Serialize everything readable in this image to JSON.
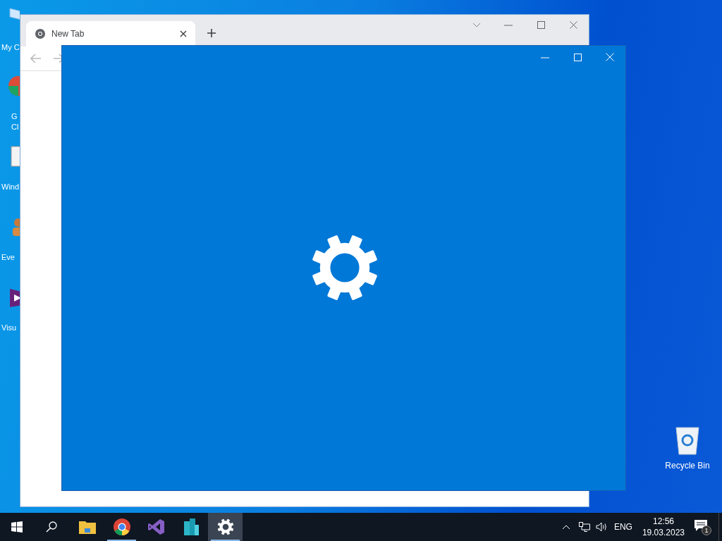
{
  "desktop_icons": [
    {
      "kind": "pc",
      "lines": [
        "My C"
      ]
    },
    {
      "kind": "chrome",
      "lines": [
        "G",
        "Cl"
      ]
    },
    {
      "kind": "notepad",
      "lines": [
        "Wind"
      ]
    },
    {
      "kind": "person",
      "lines": [
        "Eve"
      ]
    },
    {
      "kind": "vs",
      "lines": [
        "Visu"
      ]
    }
  ],
  "recycle_bin": {
    "label": "Recycle Bin"
  },
  "browser": {
    "tabs": [
      {
        "title": "New Tab",
        "selected": true
      }
    ]
  },
  "settings_window": {
    "kind": "splash"
  },
  "taskbar": {
    "items": [
      {
        "kind": "start",
        "running": false,
        "active": false
      },
      {
        "kind": "search",
        "running": false,
        "active": false
      },
      {
        "kind": "explorer",
        "running": false,
        "active": false
      },
      {
        "kind": "chrome",
        "running": true,
        "active": false
      },
      {
        "kind": "vs",
        "running": false,
        "active": false
      },
      {
        "kind": "buildings",
        "running": false,
        "active": false
      },
      {
        "kind": "settings",
        "running": true,
        "active": true
      }
    ],
    "language": "ENG",
    "time": "12:56",
    "date": "19.03.2023",
    "notifications": "1"
  }
}
